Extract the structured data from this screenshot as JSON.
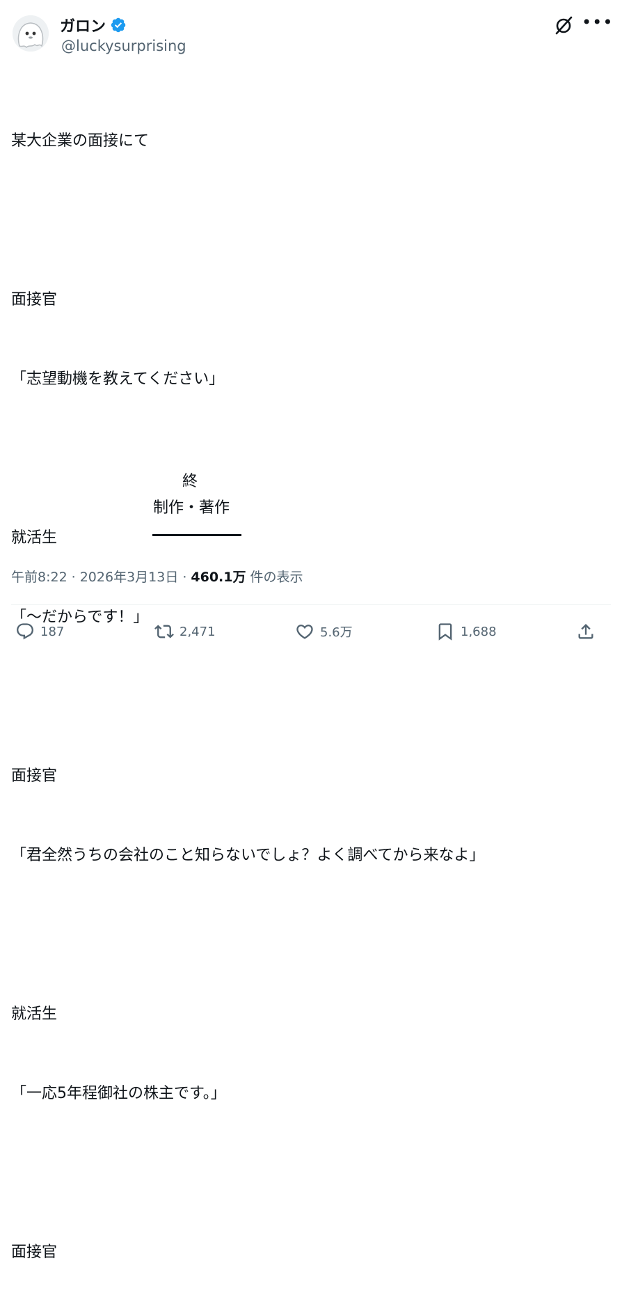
{
  "author": {
    "display_name": "ガロン",
    "handle": "@luckysurprising",
    "verified": true,
    "verified_color": "#1d9bf0"
  },
  "tweet": {
    "lines": [
      "某大企業の面接にて",
      "",
      "面接官",
      "「志望動機を教えてください」",
      "",
      "就活生",
      "「〜だからです！」",
      "",
      "面接官",
      "「君全然うちの会社のこと知らないでしょ？よく調べてから来なよ」",
      "",
      "就活生",
      "「一応5年程御社の株主です。」",
      "",
      "面接官",
      "「…」"
    ],
    "credit_end": "終",
    "credit_role": "制作・著作"
  },
  "meta": {
    "time": "午前8:22",
    "separator": "·",
    "date": "2026年3月13日",
    "views_count": "460.1万",
    "views_label": "件の表示"
  },
  "actions": {
    "replies": "187",
    "retweets": "2,471",
    "likes": "5.6万",
    "bookmarks": "1,688"
  },
  "icons": {
    "grok": "grok-icon",
    "more": "more-icon",
    "reply": "reply-icon",
    "retweet": "retweet-icon",
    "like": "heart-icon",
    "bookmark": "bookmark-icon",
    "share": "share-icon"
  }
}
